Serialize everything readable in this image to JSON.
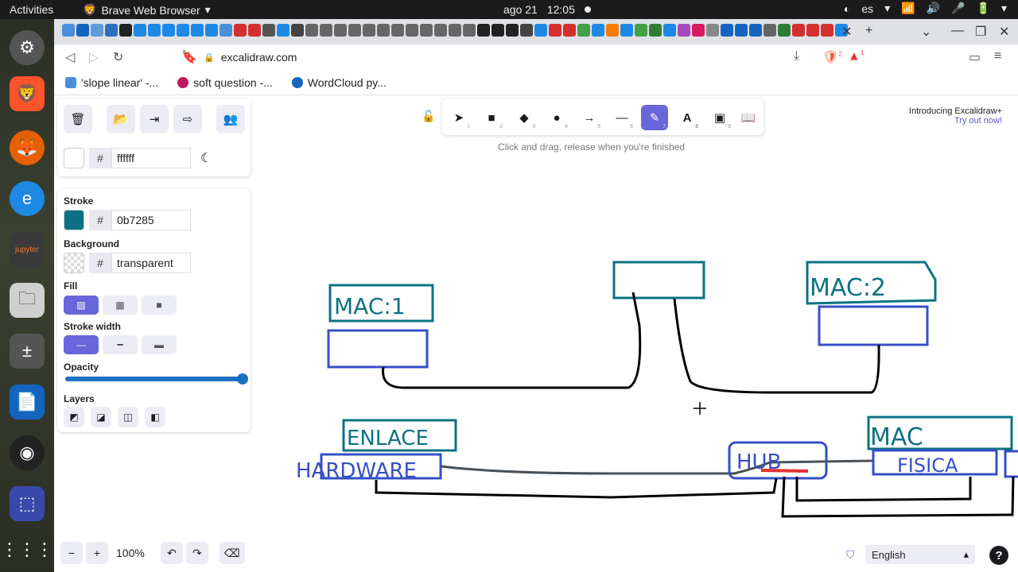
{
  "system": {
    "activities": "Activities",
    "app_name": "Brave Web Browser",
    "date": "ago 21",
    "time": "12:05",
    "lang": "es"
  },
  "dock": {
    "items": [
      "settings-icon",
      "brave-icon",
      "firefox-icon",
      "edge-icon",
      "jupyter-icon",
      "files-icon",
      "calculator-icon",
      "writer-icon",
      "obs-icon",
      "screenshot-icon",
      "apps-grid-icon"
    ]
  },
  "browser": {
    "url": "excalidraw.com",
    "brave_badge": "2",
    "rewards_badge": "1",
    "bookmarks": [
      {
        "label": "'slope linear' -...",
        "color": "#4a8fd8"
      },
      {
        "label": "soft question -...",
        "color": "#c2185b"
      },
      {
        "label": "WordCloud py...",
        "color": "#1565c0"
      }
    ],
    "tab_colors": [
      "#4a8fd8",
      "#1565c0",
      "#5d9ad8",
      "#2c6fbf",
      "#222",
      "#1e88e5",
      "#1e88e5",
      "#1e88e5",
      "#1e88e5",
      "#1e88e5",
      "#1e88e5",
      "#4a8fd8",
      "#d32f2f",
      "#d32f2f",
      "#555",
      "#1e88e5",
      "#444",
      "#666",
      "#666",
      "#666",
      "#666",
      "#666",
      "#666",
      "#666",
      "#666",
      "#666",
      "#666",
      "#666",
      "#666",
      "#222",
      "#222",
      "#222",
      "#444",
      "#1e88e5",
      "#d32f2f",
      "#d32f2f",
      "#43a047",
      "#1e88e5",
      "#f57c00",
      "#1e88e5",
      "#43a047",
      "#2e7d32",
      "#1e88e5",
      "#ab47bc",
      "#d81b60",
      "#888",
      "#1565c0",
      "#1565c0",
      "#1565c0",
      "#666",
      "#2e7d32",
      "#d32f2f",
      "#d32f2f",
      "#d32f2f",
      "#1e88e5"
    ]
  },
  "excalidraw": {
    "canvas_bg_hex": "ffffff",
    "stroke_label": "Stroke",
    "stroke_hex": "0b7285",
    "stroke_color": "#0b7285",
    "background_label": "Background",
    "background_hex": "transparent",
    "fill_label": "Fill",
    "stroke_width_label": "Stroke width",
    "opacity_label": "Opacity",
    "layers_label": "Layers",
    "hint": "Click and drag, release when you're finished",
    "promo_title": "Introducing Excalidraw+",
    "promo_link": "Try out now!",
    "zoom": "100%",
    "language": "English",
    "help": "?",
    "tool_numbers": [
      "1",
      "2",
      "3",
      "4",
      "5",
      "6",
      "7",
      "8",
      "9"
    ],
    "drawing_texts": {
      "mac1": "MAC:1",
      "mac2": "MAC:2",
      "enlace": "ENLACE",
      "hardware": "HARDWARE",
      "hub": "HUB",
      "mac": "MAC",
      "fisica": "FISICA"
    }
  }
}
